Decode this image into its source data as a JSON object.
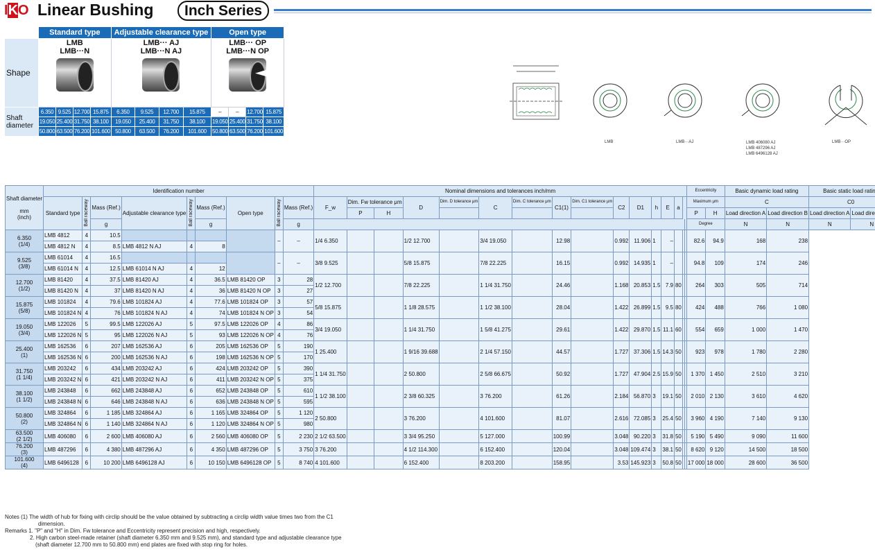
{
  "header": {
    "logo": "IKO",
    "title": "Linear Bushing",
    "series": "Inch Series"
  },
  "shape_table": {
    "types": [
      "Standard type",
      "Adjustable clearance type",
      "Open type"
    ],
    "models": [
      [
        "LMB",
        "LMB···N"
      ],
      [
        "LMB···  AJ",
        "LMB···N AJ"
      ],
      [
        "LMB···  OP",
        "LMB···N OP"
      ]
    ],
    "shape_label": "Shape",
    "shaft_label": "Shaft diameter",
    "rows": [
      [
        "6.350",
        "9.525",
        "12.700",
        "15.875",
        "6.350",
        "9.525",
        "12.700",
        "15.875",
        "–",
        "–",
        "12.700",
        "15.875"
      ],
      [
        "19.050",
        "25.400",
        "31.750",
        "38.100",
        "19.050",
        "25.400",
        "31.750",
        "38.100",
        "19.050",
        "25.400",
        "31.750",
        "38.100"
      ],
      [
        "50.800",
        "63.500",
        "76.200",
        "101.600",
        "50.800",
        "63.500",
        "76.200",
        "101.600",
        "50.800",
        "63.500",
        "76.200",
        "101.600"
      ]
    ]
  },
  "drawings": {
    "captions": [
      "LMB",
      "LMB···AJ",
      "LMB 406080 AJ\nLMB 487296 AJ\nLMB 6496128 AJ",
      "LMB···OP"
    ]
  },
  "table": {
    "h_shaft": "Shaft diameter",
    "h_mm": "mm",
    "h_inch": "(inch)",
    "h_ident": "Identification number",
    "h_nominal": "Nominal dimensions and tolerances  inch/mm",
    "h_ecc": "Eccentricity",
    "h_dyn": "Basic dynamic load rating",
    "h_sta": "Basic static load rating",
    "h_std": "Standard type",
    "h_adj": "Adjustable clearance type",
    "h_open": "Open type",
    "h_ball": "Ball raceway",
    "h_mass": "Mass (Ref.)",
    "h_g": "g",
    "h_fw": "F_w",
    "h_fwtol": "Dim. Fw tolerance μm",
    "h_P": "P",
    "h_H": "H",
    "h_D": "D",
    "h_Dtol": "Dim. D tolerance μm",
    "h_C": "C",
    "h_Ctol": "Dim. C tolerance μm",
    "h_C1": "C1(1)",
    "h_C1tol": "Dim. C1 tolerance μm",
    "h_C2": "C2",
    "h_D1": "D1",
    "h_h": "h",
    "h_E": "E",
    "h_a": "a",
    "h_max": "Maximum μm",
    "h_deg": "Degree",
    "h_C_load": "C",
    "h_C0": "C0",
    "h_dirA": "Load direction A",
    "h_dirB": "Load direction B",
    "h_N": "N",
    "rows": [
      {
        "shaft": "6.350",
        "inch": "(1/4)",
        "std": [
          [
            "LMB   4812",
            "4",
            "10.5"
          ],
          [
            "LMB   4812 N",
            "4",
            "8.5"
          ]
        ],
        "adj": [
          [
            "",
            "",
            " "
          ],
          [
            "LMB   4812 N AJ",
            "4",
            "8"
          ]
        ],
        "open": "–",
        "fw": "1/4 6.350",
        "D": "1/2 12.700",
        "C": "3/4 19.050",
        "C1": "12.98",
        "C2": "0.992",
        "D1": "11.906",
        "h": "1",
        "E": "–",
        "CA": "82.6",
        "CB": "94.9",
        "C0A": "168",
        "C0B": "238"
      },
      {
        "shaft": "9.525",
        "inch": "(3/8)",
        "std": [
          [
            "LMB   61014",
            "4",
            "16.5"
          ],
          [
            "LMB   61014 N",
            "4",
            "12.5"
          ]
        ],
        "adj": [
          [
            "",
            "",
            ""
          ],
          [
            "LMB   61014 N AJ",
            "4",
            "12"
          ]
        ],
        "open": "–",
        "fw": "3/8 9.525",
        "D": "5/8 15.875",
        "C": "7/8 22.225",
        "C1": "16.15",
        "C2": "0.992",
        "D1": "14.935",
        "h": "1",
        "E": "–",
        "CA": "94.8",
        "CB": "109",
        "C0A": "174",
        "C0B": "246"
      },
      {
        "shaft": "12.700",
        "inch": "(1/2)",
        "std": [
          [
            "LMB   81420",
            "4",
            "37.5"
          ],
          [
            "LMB   81420 N",
            "4",
            "37"
          ]
        ],
        "adj": [
          [
            "LMB   81420  AJ",
            "4",
            "36.5"
          ],
          [
            "LMB   81420 N AJ",
            "4",
            "36"
          ]
        ],
        "op": [
          [
            "LMB   81420  OP",
            "3",
            "28"
          ],
          [
            "LMB   81420 N OP",
            "3",
            "27"
          ]
        ],
        "fw": "1/2 12.700",
        "D": "7/8 22.225",
        "C": "1 1/4 31.750",
        "C1": "24.46",
        "C2": "1.168",
        "D1": "20.853",
        "h": "1.5",
        "E": "7.9",
        "a": "80",
        "CA": "264",
        "CB": "303",
        "C0A": "505",
        "C0B": "714"
      },
      {
        "shaft": "15.875",
        "inch": "(5/8)",
        "std": [
          [
            "LMB   101824",
            "4",
            "79.6"
          ],
          [
            "LMB   101824 N",
            "4",
            "76"
          ]
        ],
        "adj": [
          [
            "LMB   101824  AJ",
            "4",
            "77.6"
          ],
          [
            "LMB   101824 N AJ",
            "4",
            "74"
          ]
        ],
        "op": [
          [
            "LMB   101824  OP",
            "3",
            "57"
          ],
          [
            "LMB   101824 N OP",
            "3",
            "54"
          ]
        ],
        "fw": "5/8 15.875",
        "D": "1 1/8 28.575",
        "C": "1 1/2 38.100",
        "C1": "28.04",
        "C2": "1.422",
        "D1": "26.899",
        "h": "1.5",
        "E": "9.5",
        "a": "80",
        "CA": "424",
        "CB": "488",
        "C0A": "766",
        "C0B": "1 080"
      },
      {
        "shaft": "19.050",
        "inch": "(3/4)",
        "std": [
          [
            "LMB   122026",
            "5",
            "99.5"
          ],
          [
            "LMB   122026 N",
            "5",
            "95"
          ]
        ],
        "adj": [
          [
            "LMB   122026  AJ",
            "5",
            "97.5"
          ],
          [
            "LMB   122026 N AJ",
            "5",
            "93"
          ]
        ],
        "op": [
          [
            "LMB   122026  OP",
            "4",
            "86"
          ],
          [
            "LMB   122026 N OP",
            "4",
            "76"
          ]
        ],
        "fw": "3/4 19.050",
        "D": "1 1/4 31.750",
        "C": "1 5/8 41.275",
        "C1": "29.61",
        "C2": "1.422",
        "D1": "29.870",
        "h": "1.5",
        "E": "11.1",
        "a": "60",
        "CA": "554",
        "CB": "659",
        "C0A": "1 000",
        "C0B": "1 470"
      },
      {
        "shaft": "25.400",
        "inch": "(1)",
        "std": [
          [
            "LMB   162536",
            "6",
            "207"
          ],
          [
            "LMB   162536 N",
            "6",
            "200"
          ]
        ],
        "adj": [
          [
            "LMB   162536  AJ",
            "6",
            "205"
          ],
          [
            "LMB   162536 N AJ",
            "6",
            "198"
          ]
        ],
        "op": [
          [
            "LMB   162536  OP",
            "5",
            "190"
          ],
          [
            "LMB   162536 N OP",
            "5",
            "170"
          ]
        ],
        "fw": "1 25.400",
        "D": "1 9/16 39.688",
        "C": "2 1/4 57.150",
        "C1": "44.57",
        "C2": "1.727",
        "D1": "37.306",
        "h": "1.5",
        "E": "14.3",
        "a": "50",
        "CA": "923",
        "CB": "978",
        "C0A": "1 780",
        "C0B": "2 280"
      },
      {
        "shaft": "31.750",
        "inch": "(1 1/4)",
        "std": [
          [
            "LMB   203242",
            "6",
            "434"
          ],
          [
            "LMB   203242 N",
            "6",
            "421"
          ]
        ],
        "adj": [
          [
            "LMB   203242  AJ",
            "6",
            "424"
          ],
          [
            "LMB   203242 N AJ",
            "6",
            "411"
          ]
        ],
        "op": [
          [
            "LMB   203242  OP",
            "5",
            "390"
          ],
          [
            "LMB   203242 N OP",
            "5",
            "375"
          ]
        ],
        "fw": "1 1/4 31.750",
        "D": "2 50.800",
        "C": "2 5/8 66.675",
        "C1": "50.92",
        "C2": "1.727",
        "D1": "47.904",
        "h": "2.5",
        "E": "15.9",
        "a": "50",
        "CA": "1 370",
        "CB": "1 450",
        "C0A": "2 510",
        "C0B": "3 210"
      },
      {
        "shaft": "38.100",
        "inch": "(1 1/2)",
        "std": [
          [
            "LMB   243848",
            "6",
            "662"
          ],
          [
            "LMB   243848 N",
            "6",
            "646"
          ]
        ],
        "adj": [
          [
            "LMB   243848  AJ",
            "6",
            "652"
          ],
          [
            "LMB   243848 N AJ",
            "6",
            "636"
          ]
        ],
        "op": [
          [
            "LMB   243848  OP",
            "5",
            "610"
          ],
          [
            "LMB   243848 N OP",
            "5",
            "595"
          ]
        ],
        "fw": "1 1/2 38.100",
        "D": "2 3/8 60.325",
        "C": "3 76.200",
        "C1": "61.26",
        "C2": "2.184",
        "D1": "56.870",
        "h": "3",
        "E": "19.1",
        "a": "50",
        "CA": "2 010",
        "CB": "2 130",
        "C0A": "3 610",
        "C0B": "4 620"
      },
      {
        "shaft": "50.800",
        "inch": "(2)",
        "std": [
          [
            "LMB   324864",
            "6",
            "1 185"
          ],
          [
            "LMB   324864 N",
            "6",
            "1 140"
          ]
        ],
        "adj": [
          [
            "LMB   324864  AJ",
            "6",
            "1 165"
          ],
          [
            "LMB   324864 N AJ",
            "6",
            "1 120"
          ]
        ],
        "op": [
          [
            "LMB   324864  OP",
            "5",
            "1 120"
          ],
          [
            "LMB   324864 N OP",
            "5",
            "980"
          ]
        ],
        "fw": "2 50.800",
        "D": "3 76.200",
        "C": "4 101.600",
        "C1": "81.07",
        "C2": "2.616",
        "D1": "72.085",
        "h": "3",
        "E": "25.4",
        "a": "50",
        "CA": "3 960",
        "CB": "4 190",
        "C0A": "7 140",
        "C0B": "9 130"
      },
      {
        "shaft": "63.500",
        "inch": "(2 1/2)",
        "single": [
          "LMB   406080",
          "6",
          "2 600",
          "LMB   406080  AJ",
          "6",
          "2 560",
          "LMB   406080  OP",
          "5",
          "2 230"
        ],
        "fw": "2 1/2 63.500",
        "D": "3 3/4 95.250",
        "C": "5 127.000",
        "C1": "100.99",
        "C2": "3.048",
        "D1": "90.220",
        "h": "3",
        "E": "31.8",
        "a": "50",
        "CA": "5 190",
        "CB": "5 490",
        "C0A": "9 090",
        "C0B": "11 600"
      },
      {
        "shaft": "76.200",
        "inch": "(3)",
        "single": [
          "LMB   487296",
          "6",
          "4 380",
          "LMB   487296  AJ",
          "6",
          "4 350",
          "LMB   487296  OP",
          "5",
          "3 750"
        ],
        "fw": "3 76.200",
        "D": "4 1/2 114.300",
        "C": "6 152.400",
        "C1": "120.04",
        "C2": "3.048",
        "D1": "109.474",
        "h": "3",
        "E": "38.1",
        "a": "50",
        "CA": "8 620",
        "CB": "9 120",
        "C0A": "14 500",
        "C0B": "18 500"
      },
      {
        "shaft": "101.600",
        "inch": "(4)",
        "single": [
          "LMB   6496128",
          "6",
          "10 200",
          "LMB   6496128  AJ",
          "6",
          "10 150",
          "LMB   6496128  OP",
          "5",
          "8 740"
        ],
        "fw": "4 101.600",
        "D": "6 152.400",
        "C": "8 203.200",
        "C1": "158.95",
        "C2": "3.53",
        "D1": "145.923",
        "h": "3",
        "E": "50.8",
        "a": "50",
        "CA": "17 000",
        "CB": "18 000",
        "C0A": "28 600",
        "C0B": "36 500"
      }
    ]
  },
  "notes": [
    "Notes (1)  The width of hub for fixing with circlip should be the value obtained by subtracting a circlip width value times two from the C1",
    "dimension.",
    "Remarks 1. \"P\" and \"H\" in Dim. Fw tolerance and Eccentricity represent precision and high, respectively.",
    "2. High carbon steel-made retainer (shaft diameter 6.350 mm and 9.525 mm), and standard type and adjustable clearance type",
    "(shaft diameter 12.700 mm to 50.800 mm) end plates are fixed with stop ring for holes."
  ]
}
